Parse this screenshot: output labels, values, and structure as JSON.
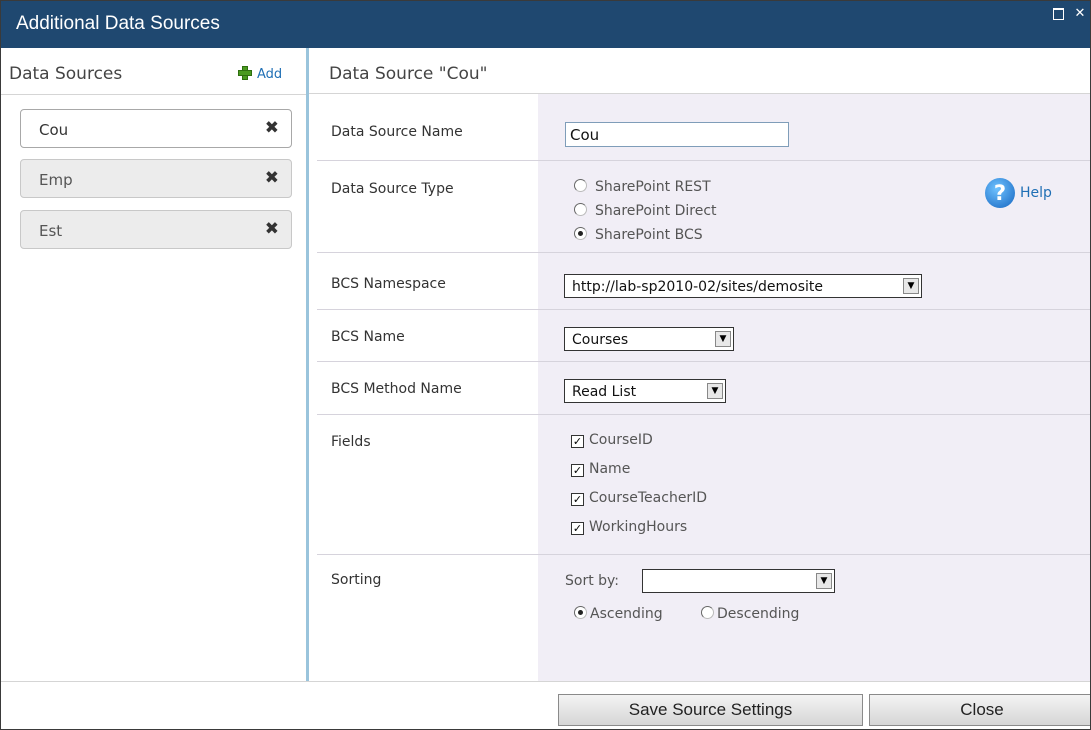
{
  "window": {
    "title": "Additional Data Sources",
    "maximize_icon": "maximize-icon",
    "close_icon": "close-icon"
  },
  "sidebar": {
    "heading": "Data Sources",
    "add_label": "Add",
    "items": [
      {
        "label": "Cou",
        "active": true
      },
      {
        "label": "Emp",
        "active": false
      },
      {
        "label": "Est",
        "active": false
      }
    ]
  },
  "main": {
    "heading": "Data Source \"Cou\"",
    "name_label": "Data Source Name",
    "name_value": "Cou",
    "type_label": "Data Source Type",
    "type_options": [
      "SharePoint REST",
      "SharePoint Direct",
      "SharePoint BCS"
    ],
    "type_selected": "SharePoint BCS",
    "help_label": "Help",
    "namespace_label": "BCS Namespace",
    "namespace_value": "http://lab-sp2010-02/sites/demosite",
    "bcs_name_label": "BCS Name",
    "bcs_name_value": "Courses",
    "method_label": "BCS Method Name",
    "method_value": "Read List",
    "fields_label": "Fields",
    "fields": [
      {
        "label": "CourseID",
        "checked": true
      },
      {
        "label": "Name",
        "checked": true
      },
      {
        "label": "CourseTeacherID",
        "checked": true
      },
      {
        "label": "WorkingHours",
        "checked": true
      }
    ],
    "sorting_label": "Sorting",
    "sort_by_label": "Sort by:",
    "sort_by_value": "",
    "order_options": [
      "Ascending",
      "Descending"
    ],
    "order_selected": "Ascending"
  },
  "footer": {
    "save_label": "Save Source Settings",
    "close_label": "Close"
  },
  "colors": {
    "titlebar": "#1f4870",
    "accent": "#1f6fb5",
    "splitter": "#9ac4dc",
    "value_bg": "#f1eef6"
  }
}
